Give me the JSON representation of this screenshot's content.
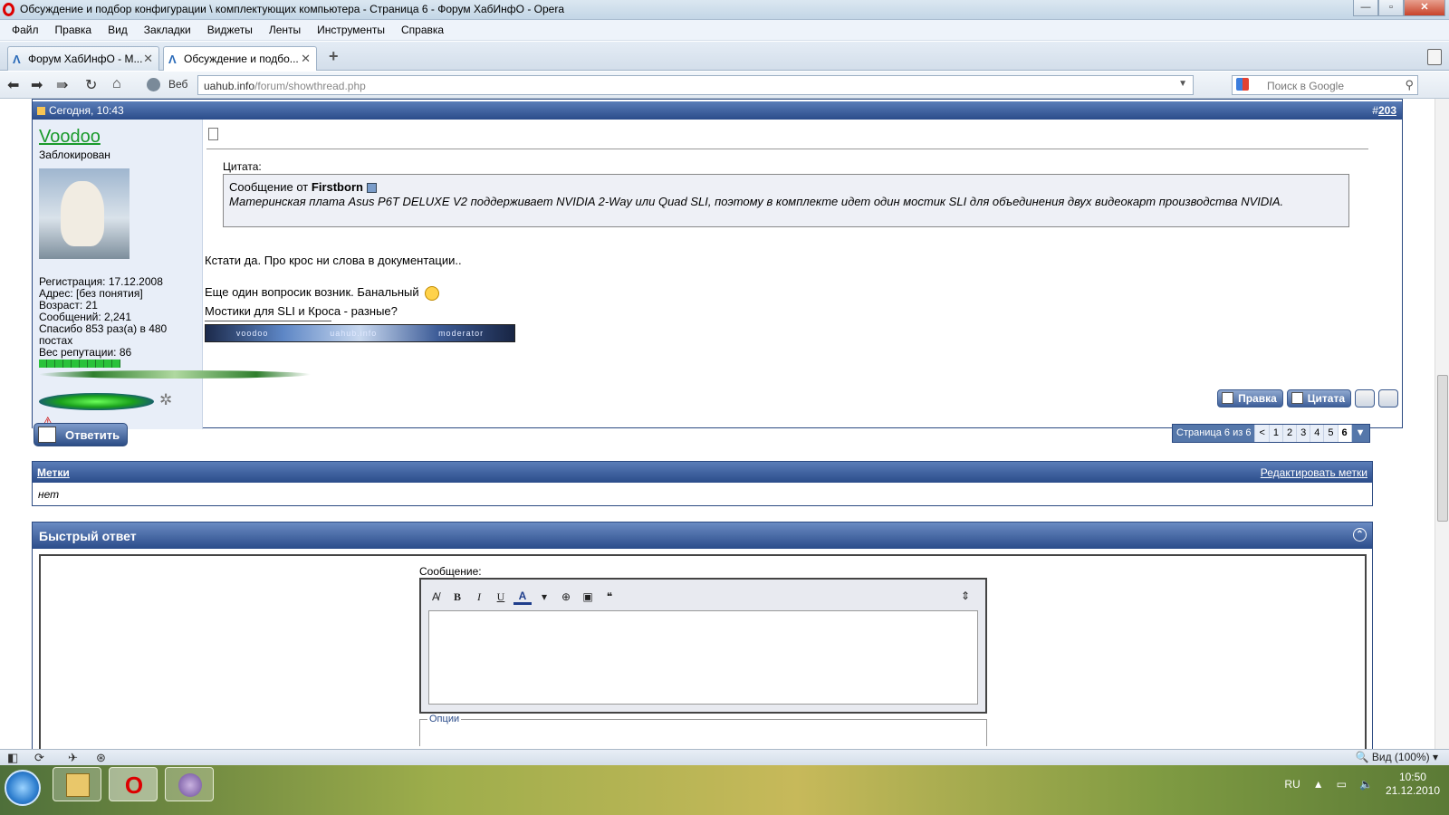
{
  "window": {
    "title": "Обсуждение и подбор конфигурации \\ комплектующих компьютера - Страница 6 - Форум ХабИнфО - Opera",
    "btn_min": "—",
    "btn_max": "▫",
    "btn_close": "✕"
  },
  "menu": [
    "Файл",
    "Правка",
    "Вид",
    "Закладки",
    "Виджеты",
    "Ленты",
    "Инструменты",
    "Справка"
  ],
  "tabs": [
    {
      "label": "Форум ХабИнфО - М...",
      "active": false
    },
    {
      "label": "Обсуждение и подбо...",
      "active": true
    }
  ],
  "icons": {
    "tab": "Λ",
    "close": "✕",
    "add": "+",
    "back": "⬅",
    "forward": "➡",
    "fast_forward": "⇛",
    "reload": "↻",
    "home": "⌂",
    "dropdown": "▼",
    "search": "⚲",
    "gear": "✲",
    "warning": "⚠",
    "collapse": "⌃",
    "toggle_panel": "◧",
    "sync": "⟳",
    "unite": "✈",
    "turbo": "⊛",
    "status_dd": "▾",
    "zoom": "🔍",
    "opera": "O",
    "tray_up": "▲",
    "tray_network": "▭",
    "tray_volume": "🔈"
  },
  "addressbar": {
    "web_label": "Веб",
    "url_host": "uahub.info",
    "url_path": "/forum/showthread.php",
    "search_placeholder": "Поиск в Google"
  },
  "post": {
    "date": "Сегодня, 10:43",
    "number_prefix": "#",
    "number": "203",
    "username": "Voodoo",
    "user_status": "Заблокирован",
    "info": [
      "Регистрация: 17.12.2008",
      "Адрес: [без понятия]",
      "Возраст: 21",
      "Сообщений: 2,241",
      "Спасибо 853 раз(а) в 480 постах",
      "Вес репутации: 86"
    ],
    "reputation_level": 10,
    "quote_label": "Цитата:",
    "quote_from_prefix": "Сообщение от",
    "quote_author": "Firstborn",
    "quote_text": "Материнская плата Asus P6T DELUXE V2 поддерживает NVIDIA 2-Way или Quad SLI, поэтому в комплекте идет один мостик SLI для объединения двух видеокарт производства NVIDIA.",
    "lines": [
      "Кстати да. Про крос ни слова в документации..",
      "Еще один вопросик возник. Банальный",
      "Мостики для SLI и Кроса - разные?"
    ],
    "signature_banner": [
      "voodoo",
      "uahub.info",
      "moderator"
    ],
    "buttons": {
      "edit": "Правка",
      "quote": "Цитата"
    }
  },
  "reply_button": "Ответить",
  "pagination": {
    "label": "Страница 6 из 6",
    "prev": "<",
    "pages": [
      "1",
      "2",
      "3",
      "4",
      "5",
      "6"
    ],
    "current": "6"
  },
  "tags": {
    "title": "Метки",
    "edit_link": "Редактировать метки",
    "value": "нет"
  },
  "quick_reply": {
    "title": "Быстрый ответ",
    "message_label": "Сообщение:",
    "toolbar": [
      "B",
      "I",
      "U",
      "A"
    ],
    "options_label": "Опции"
  },
  "statusbar": {
    "zoom": "Вид (100%)"
  },
  "taskbar": {
    "lang": "RU",
    "time": "10:50",
    "date": "21.12.2010"
  },
  "colors": {
    "header_blue": "#2b4c8a",
    "username_green": "#1a9a2c",
    "panel_light": "#e8eef8"
  }
}
